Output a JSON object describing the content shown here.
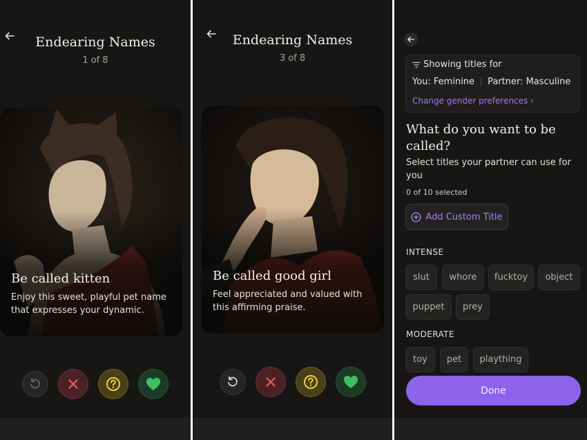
{
  "screens": [
    {
      "title": "Endearing Names",
      "counter": "1 of 8",
      "card": {
        "title": "Be called kitten",
        "description": "Enjoy this sweet, playful pet name that expresses your dynamic."
      }
    },
    {
      "title": "Endearing Names",
      "counter": "3 of 8",
      "card": {
        "title": "Be called good girl",
        "description": "Feel appreciated and valued with this affirming praise."
      }
    }
  ],
  "preferences": {
    "header": "Showing titles for",
    "you": "You: Feminine",
    "partner": "Partner: Masculine",
    "change_link": "Change gender preferences ›",
    "question": "What do you want to be called?",
    "subtitle": "Select titles your partner can use for you",
    "selected_count": "0 of 10 selected",
    "add_custom": "Add Custom Title",
    "sections": [
      {
        "label": "INTENSE",
        "chips": [
          "slut",
          "whore",
          "fucktoy",
          "object",
          "puppet",
          "prey"
        ]
      },
      {
        "label": "MODERATE",
        "chips": [
          "toy",
          "pet",
          "plaything"
        ]
      }
    ],
    "done": "Done"
  },
  "colors": {
    "background": "#171615",
    "accent": "#8d63ec",
    "reject": "#e0575f",
    "maybe": "#f0d040",
    "like": "#3fbf62"
  },
  "icons": {
    "back": "arrow-left-icon",
    "undo": "undo-icon",
    "reject": "close-icon",
    "maybe": "question-icon",
    "like": "heart-icon",
    "filter": "filter-icon",
    "add": "plus-circle-icon"
  }
}
